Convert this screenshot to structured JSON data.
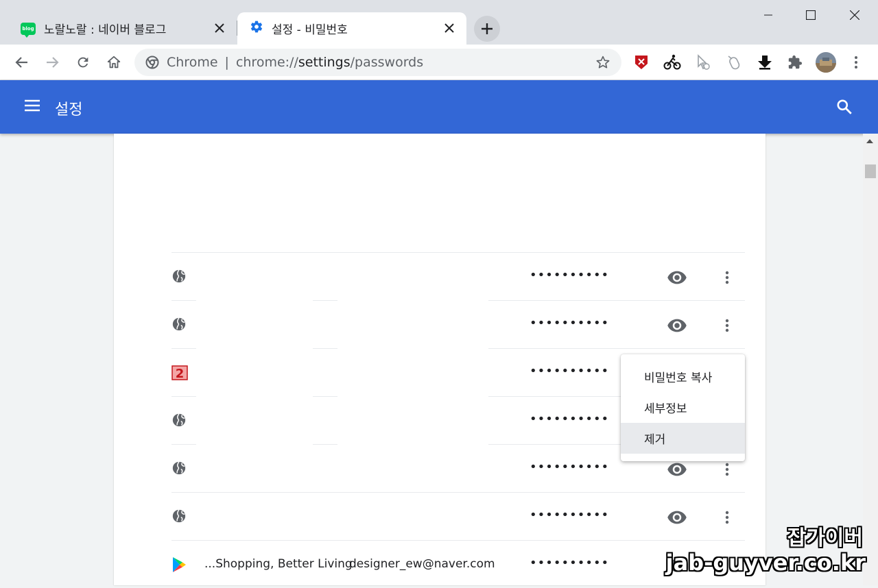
{
  "tabs": [
    {
      "label": "노랄노랄 : 네이버 블로그",
      "icon": "blog-icon",
      "active": false
    },
    {
      "label": "설정 - 비밀번호",
      "icon": "gear-icon",
      "active": true
    }
  ],
  "blog_icon_text": "blog",
  "omnibox": {
    "scheme_label": "Chrome",
    "separator": "|",
    "url_prefix": "chrome://",
    "url_host": "settings",
    "url_path": "/passwords"
  },
  "header": {
    "title": "설정"
  },
  "passwords": [
    {
      "site": "",
      "username": "",
      "password": "••••••••••",
      "icon": "globe-icon"
    },
    {
      "site": "",
      "username": "",
      "password": "••••••••••",
      "icon": "globe-icon"
    },
    {
      "site": "",
      "username": "",
      "password": "••••••••••",
      "icon": "red-2-favicon",
      "favicon_text": "2"
    },
    {
      "site": "",
      "username": "",
      "password": "••••••••••",
      "icon": "globe-icon"
    },
    {
      "site": "",
      "username": "",
      "password": "••••••••••",
      "icon": "globe-icon"
    },
    {
      "site": "",
      "username": "",
      "password": "••••••••••",
      "icon": "globe-icon"
    },
    {
      "site": "...Shopping, Better Living",
      "username": "designer_ew@naver.com",
      "password": "••••••••••",
      "icon": "google-play-icon"
    }
  ],
  "context_menu": {
    "items": [
      {
        "label": "비밀번호 복사",
        "highlighted": false
      },
      {
        "label": "세부정보",
        "highlighted": false
      },
      {
        "label": "제거",
        "highlighted": true
      }
    ]
  },
  "watermark": {
    "line1": "잡가이버",
    "line2": "jab-guyver.co.kr"
  },
  "colors": {
    "header": "#3367d6",
    "tabstrip": "#dee1e6",
    "icon_gray": "#5f6368"
  }
}
